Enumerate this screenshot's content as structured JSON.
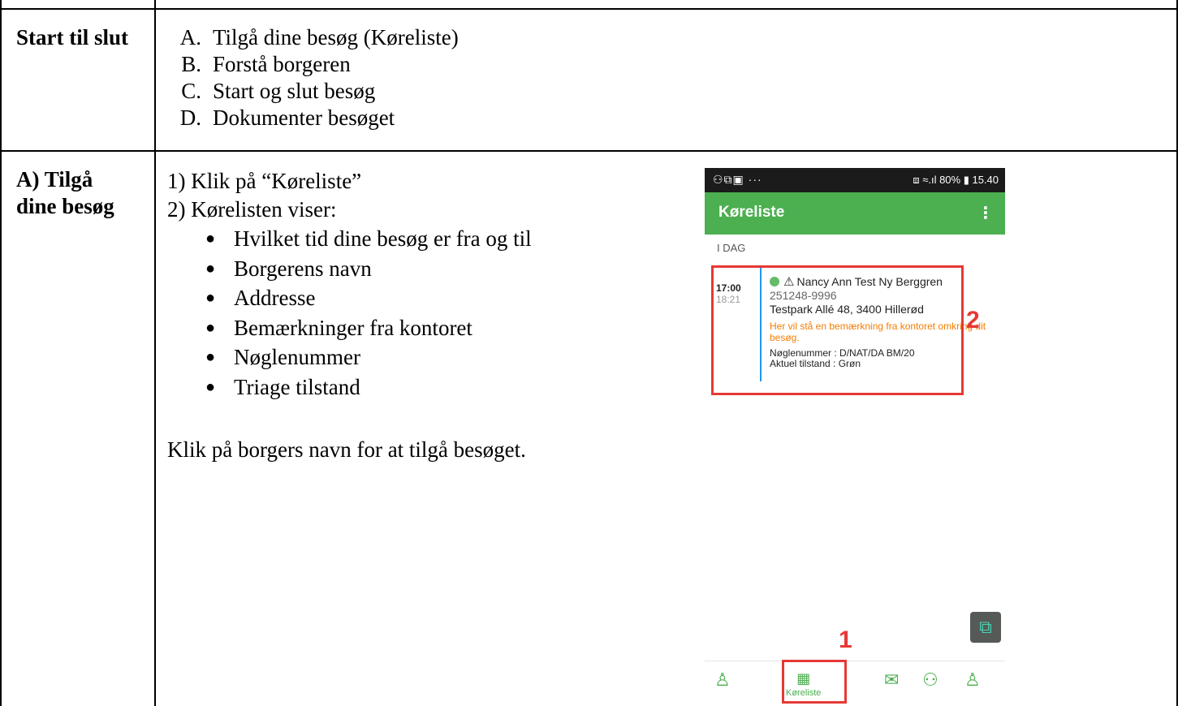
{
  "overview": {
    "label": "Start til slut",
    "items": [
      {
        "letter": "A.",
        "text": "Tilgå dine besøg (Køreliste)"
      },
      {
        "letter": "B.",
        "text": "Forstå borgeren"
      },
      {
        "letter": "C.",
        "text": "Start og slut besøg"
      },
      {
        "letter": "D.",
        "text": "Dokumenter besøget"
      }
    ]
  },
  "section_a": {
    "label_line1": "A) Tilgå",
    "label_line2": "dine besøg",
    "step1": "1) Klik på “Køreliste”",
    "step2": "2) Kørelisten viser:",
    "bullets": [
      "Hvilket tid dine besøg er fra og til",
      "Borgerens navn",
      "Addresse",
      "Bemærkninger fra kontoret",
      "Nøglenummer",
      "Triage tilstand"
    ],
    "note": "Klik på borgers navn for at tilgå besøget."
  },
  "phone": {
    "status_left": "⚇⧉▣ ···",
    "status_right": "⧈ ≈.ıl 80% ▮ 15.40",
    "app_title": "Køreliste",
    "menu_icon": "⋮",
    "day_label": "I DAG",
    "visit": {
      "start": "17:00",
      "end": "18:21",
      "name": "Nancy Ann Test Ny Berggren",
      "cpr": "251248-9996",
      "address": "Testpark Allé 48, 3400 Hillerød",
      "remark": "Her vil stå en bemærkning fra kontoret omkring dit besøg.",
      "key_number": "Nøglenummer : D/NAT/DA BM/20",
      "triage": "Aktuel tilstand : Grøn"
    },
    "marker_1": "1",
    "marker_2": "2",
    "nav_label": "Køreliste",
    "accent": "#4caf50",
    "highlight": "#e53935"
  }
}
